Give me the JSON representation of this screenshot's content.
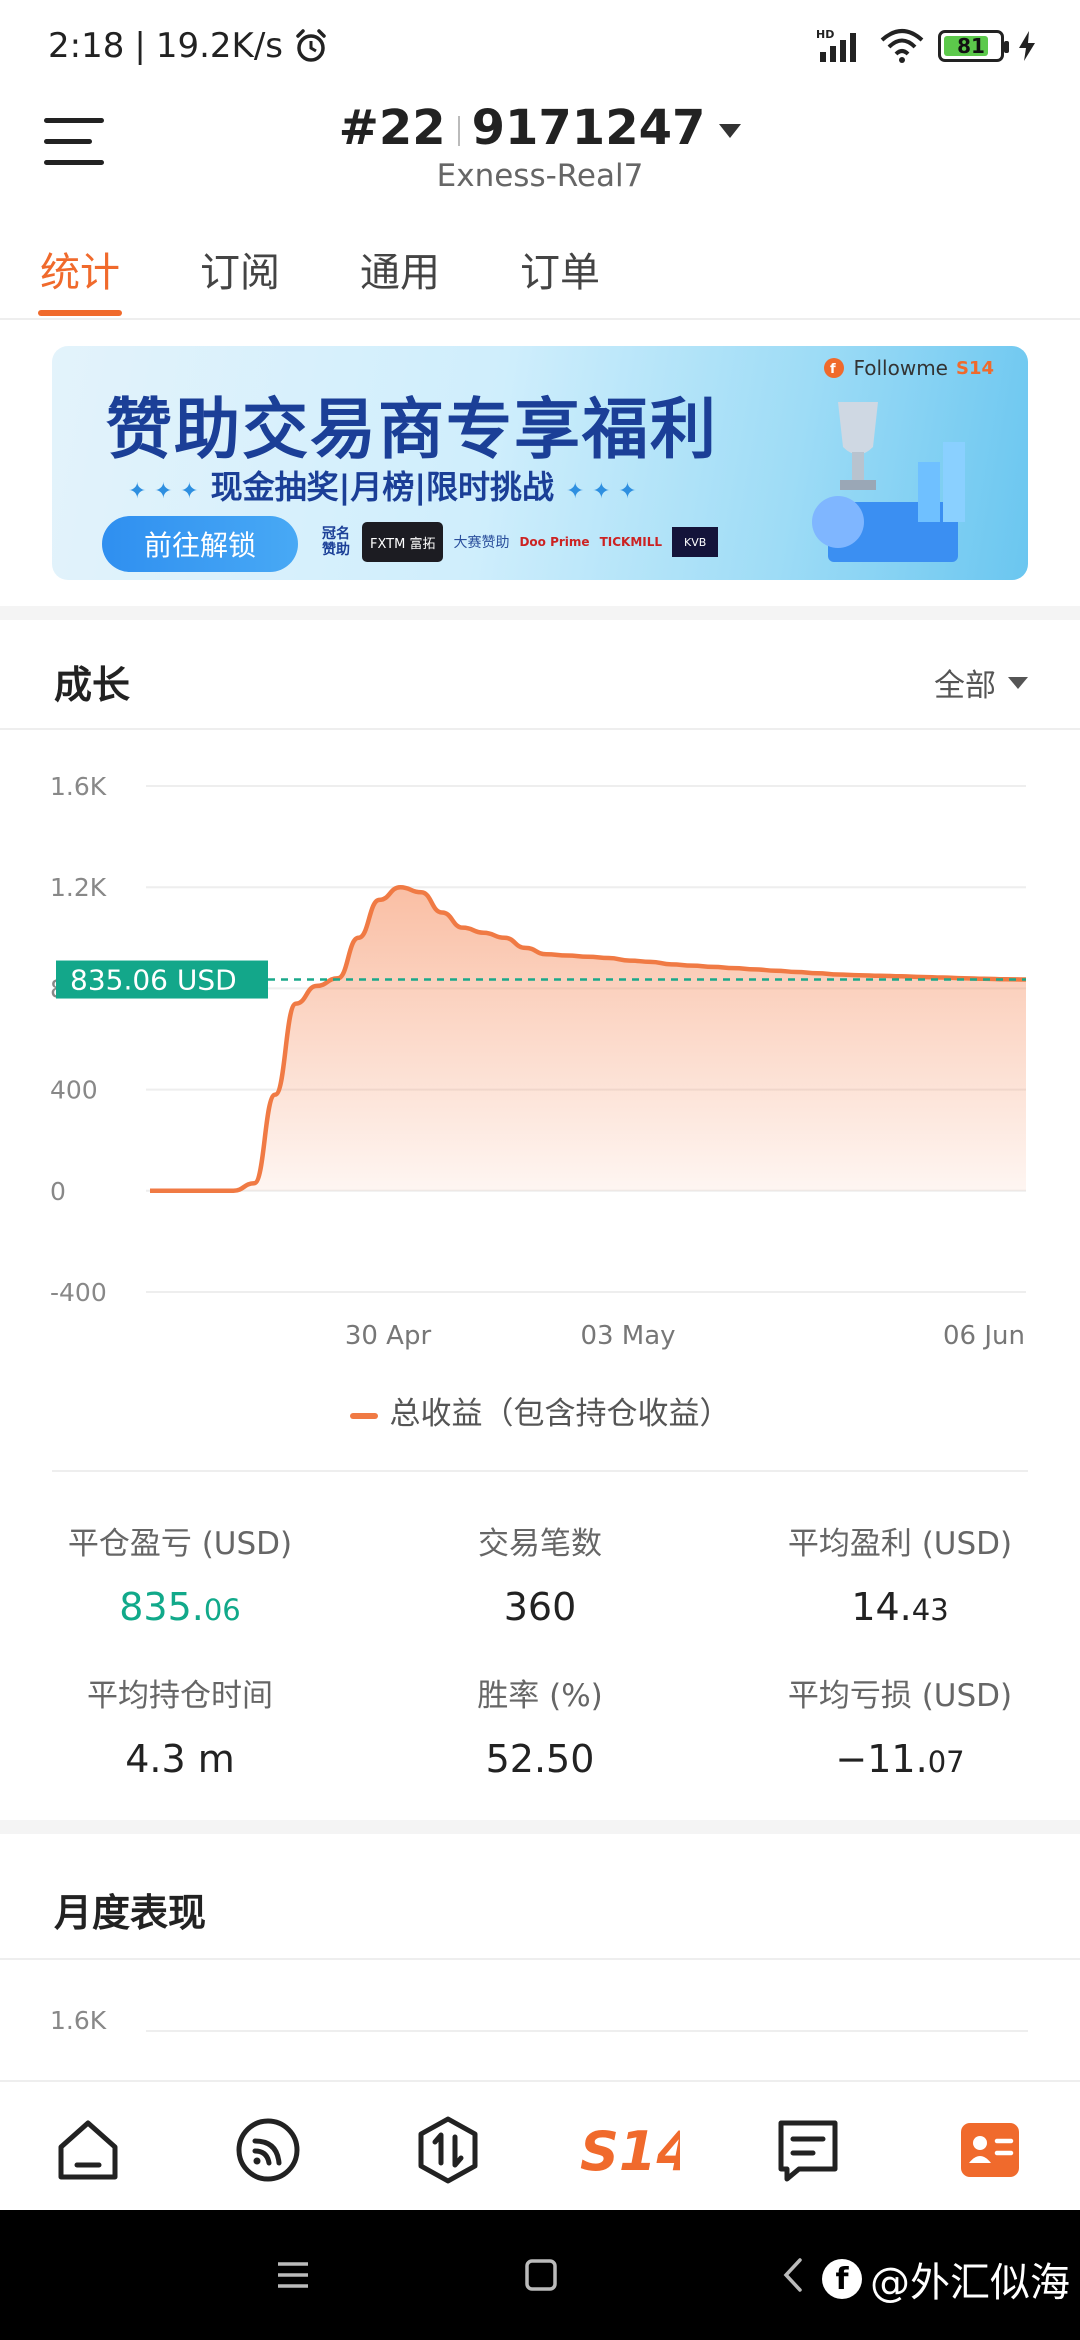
{
  "status_bar": {
    "time": "2:18",
    "net_speed": "19.2K/s",
    "signal_label": "HD",
    "battery": "81",
    "battery_level": 0.81
  },
  "header": {
    "account_prefix": "#22",
    "account_number": "9171247",
    "server": "Exness-Real7"
  },
  "tabs": [
    {
      "label": "统计",
      "active": true
    },
    {
      "label": "订阅",
      "active": false
    },
    {
      "label": "通用",
      "active": false
    },
    {
      "label": "订单",
      "active": false
    }
  ],
  "banner": {
    "title": "赞助交易商专享福利",
    "subtitle": "现金抽奖|月榜|限时挑战",
    "button": "前往解锁",
    "brand": "Followme",
    "brand_tag": "S14",
    "sponsor_label": "冠名赞助",
    "sponsor_logo": "FXTM 富拓",
    "sponsor_label_2": "大赛赞助",
    "sponsor_brands": [
      "Doo Prime",
      "TICKMILL",
      "KVB"
    ]
  },
  "growth": {
    "title": "成长",
    "range": "全部",
    "current_label": "835.06 USD",
    "legend": "总收益（包含持仓收益）"
  },
  "chart_data": {
    "type": "area",
    "x_ticks": [
      "30 Apr",
      "03 May",
      "06 Jun"
    ],
    "y_ticks": [
      "1.6K",
      "1.2K",
      "800",
      "400",
      "0",
      "-400"
    ],
    "ylim": [
      -400,
      1600
    ],
    "current_value": 835.06,
    "series": [
      {
        "name": "总收益（包含持仓收益）",
        "color": "#f07a44",
        "values": [
          0,
          0,
          0,
          0,
          0,
          30,
          380,
          740,
          810,
          840,
          1000,
          1150,
          1200,
          1180,
          1100,
          1040,
          1020,
          1000,
          960,
          935,
          930,
          925,
          920,
          910,
          905,
          895,
          890,
          885,
          880,
          875,
          870,
          865,
          860,
          855,
          852,
          850,
          848,
          845,
          843,
          840,
          838,
          836,
          835.06
        ]
      }
    ]
  },
  "stats": [
    {
      "label": "平仓盈亏 (USD)",
      "value_int": "835.",
      "value_dec": "06",
      "highlight": true
    },
    {
      "label": "交易笔数",
      "value_int": "360",
      "value_dec": "",
      "highlight": false
    },
    {
      "label": "平均盈利 (USD)",
      "value_int": "14.",
      "value_dec": "43",
      "highlight": false
    },
    {
      "label": "平均持仓时间",
      "value_int": "4.3 m",
      "value_dec": "",
      "highlight": false
    },
    {
      "label": "胜率 (%)",
      "value_int": "52.50",
      "value_dec": "",
      "highlight": false
    },
    {
      "label": "平均亏损 (USD)",
      "value_int": "−11.",
      "value_dec": "07",
      "highlight": false
    }
  ],
  "monthly": {
    "title": "月度表现",
    "first_tick": "1.6K"
  },
  "bottom_nav": {
    "center_label": "S14",
    "items": [
      "home-icon",
      "feed-icon",
      "trade-icon",
      "s14-logo",
      "message-icon",
      "profile-card-icon"
    ]
  },
  "watermark": "@外汇似海"
}
